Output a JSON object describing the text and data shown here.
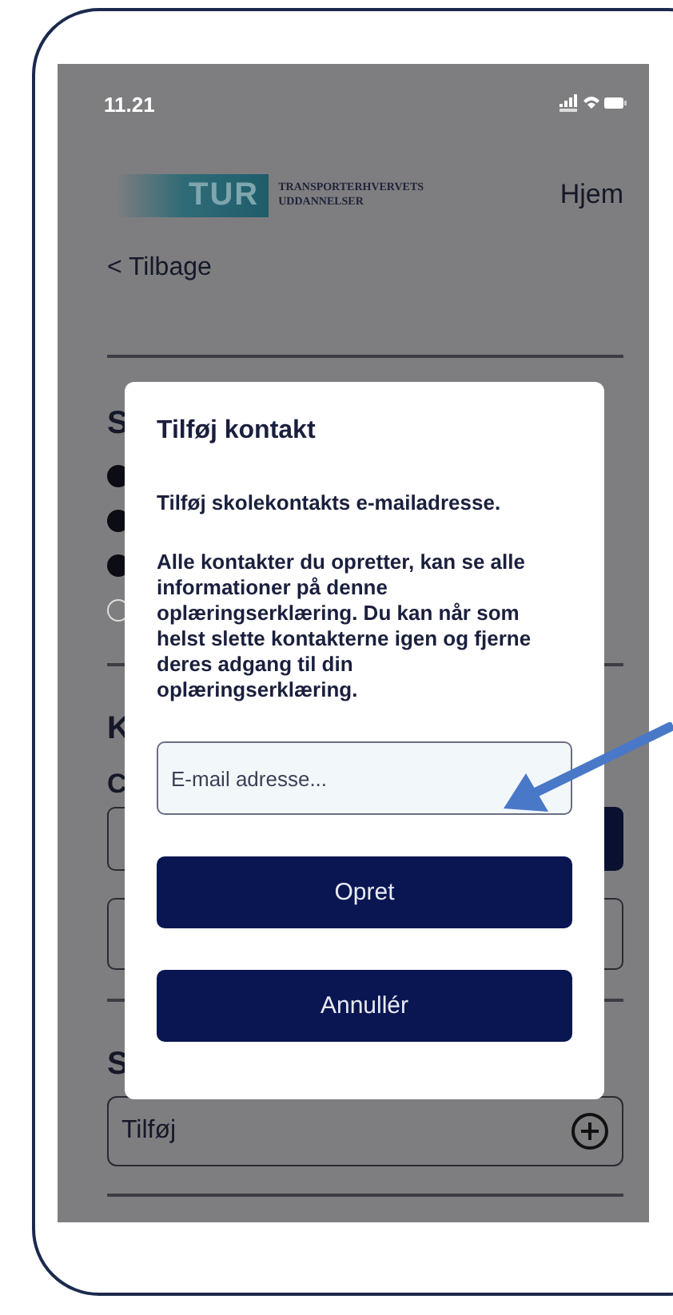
{
  "status_bar": {
    "time": "11.21"
  },
  "header": {
    "logo_mark": "TUR",
    "logo_line_1": "TRANSPORTERHVERVETS",
    "logo_line_2": "UDDANNELSER",
    "home_link": "Hjem"
  },
  "back_link": "< Tilbage",
  "section_1": {
    "heading_fragment": "S",
    "options": [
      {
        "checked": true
      },
      {
        "checked": true
      },
      {
        "checked": true
      },
      {
        "checked": false
      }
    ]
  },
  "section_2": {
    "heading_fragment": "K",
    "label_fragment": "C"
  },
  "section_3": {
    "heading_fragment": "S",
    "add_field": {
      "value": "Tilføj"
    }
  },
  "dialog": {
    "title": "Tilføj kontakt",
    "subtitle": "Tilføj skolekontakts e-mailadresse.",
    "body": "Alle kontakter du opretter, kan se alle informationer på denne oplæringserklæring. Du kan når som helst slette kontakterne igen og fjerne deres adgang til din oplæringserklæring.",
    "email_field": {
      "placeholder": "E-mail adresse..."
    },
    "buttons": [
      {
        "label": "Opret"
      },
      {
        "label": "Annullér"
      }
    ]
  }
}
